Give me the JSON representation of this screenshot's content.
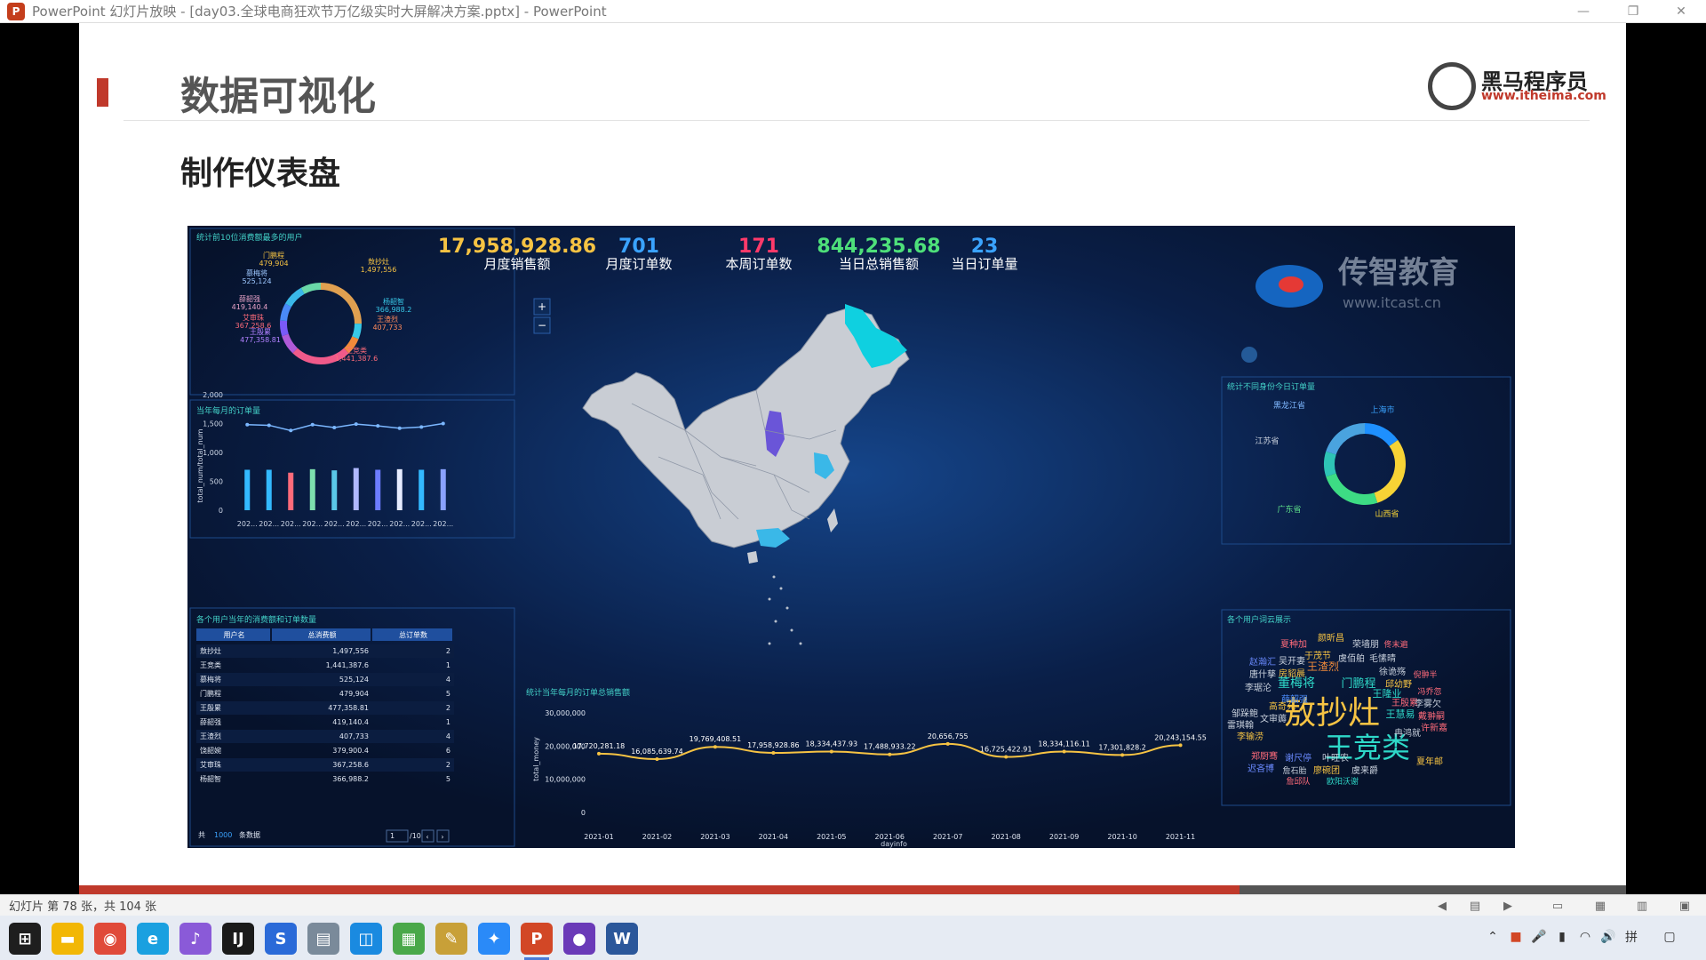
{
  "window": {
    "title": "PowerPoint 幻灯片放映 - [day03.全球电商狂欢节万亿级实时大屏解决方案.pptx] - PowerPoint",
    "app_icon": "P"
  },
  "slide": {
    "title": "数据可视化",
    "subtitle": "制作仪表盘",
    "logo": {
      "name": "黑马程序员",
      "url": "www.itheima.com"
    },
    "progress": 0.75
  },
  "dashboard": {
    "kpis": [
      {
        "value": "17,958,928.86",
        "label": "月度销售额",
        "color": "#f6c343"
      },
      {
        "value": "701",
        "label": "月度订单数",
        "color": "#3aa3ff"
      },
      {
        "value": "171",
        "label": "本周订单数",
        "color": "#ff3a6a"
      },
      {
        "value": "844,235.68",
        "label": "当日总销售额",
        "color": "#4ee07a"
      },
      {
        "value": "23",
        "label": "当日订单量",
        "color": "#3aa3ff"
      }
    ],
    "watermark": {
      "brand": "传智教育",
      "url": "www.itcast.cn"
    },
    "map_controls": {
      "zoom_in": "+",
      "zoom_out": "−"
    },
    "top_users_pie": {
      "title": "统计前10位消费额最多的用户",
      "labels": [
        {
          "name": "门鹏程",
          "value": "479,904"
        },
        {
          "name": "敖抄灶",
          "value": "1,497,556"
        },
        {
          "name": "慕梅将",
          "value": "525,124"
        },
        {
          "name": "薛韶强",
          "value": "419,140.4"
        },
        {
          "name": "杨韶智",
          "value": "366,988.2"
        },
        {
          "name": "艾审珠",
          "value": "367,258.6"
        },
        {
          "name": "王渣烈",
          "value": "407,733"
        },
        {
          "name": "王殷累",
          "value": "477,358.81"
        },
        {
          "name": "王竞类",
          "value": "1,441,387.6"
        }
      ]
    },
    "monthly_orders": {
      "title": "当年每月的订单量",
      "ylabel": "total_num/total_num",
      "yticks": [
        "2,000",
        "1,500",
        "1,000",
        "500",
        "0"
      ],
      "xticks": [
        "202...",
        "202...",
        "202...",
        "202...",
        "202...",
        "202...",
        "202...",
        "202...",
        "202...",
        "202..."
      ]
    },
    "user_table": {
      "title": "各个用户当年的消费额和订单数量",
      "headers": [
        "用户名",
        "总消费额",
        "总订单数"
      ],
      "rows": [
        [
          "敖抄灶",
          "1,497,556",
          "2"
        ],
        [
          "王竞类",
          "1,441,387.6",
          "1"
        ],
        [
          "慕梅将",
          "525,124",
          "4"
        ],
        [
          "门鹏程",
          "479,904",
          "5"
        ],
        [
          "王殷累",
          "477,358.81",
          "2"
        ],
        [
          "薛韶强",
          "419,140.4",
          "1"
        ],
        [
          "王渣烈",
          "407,733",
          "4"
        ],
        [
          "饶韶婉",
          "379,900.4",
          "6"
        ],
        [
          "艾审珠",
          "367,258.6",
          "2"
        ],
        [
          "杨韶智",
          "366,988.2",
          "5"
        ]
      ],
      "footer": {
        "prefix": "共",
        "count": "1000",
        "suffix": "条数据",
        "page": "1",
        "pages": "/10"
      }
    },
    "monthly_sales": {
      "title": "统计当年每月的订单总销售额",
      "ylabel": "total_money",
      "xlabel": "dayinfo",
      "yticks": [
        "30,000,000",
        "20,000,000",
        "10,000,000",
        "0"
      ]
    },
    "province_donut": {
      "title": "统计不同身份今日订单量",
      "labels": [
        "黑龙江省",
        "上海市",
        "江苏省",
        "广东省",
        "山西省"
      ]
    },
    "wordcloud": {
      "title": "各个用户词云展示",
      "words": [
        "敖抄灶",
        "王竞类",
        "颜昕昌",
        "夏种加",
        "荣墙朋",
        "佟末遍",
        "于茂节",
        "虞佰舶",
        "毛愫晴",
        "赵瀚汇",
        "吴开妻",
        "王渣烈",
        "董梅将",
        "门鹏程",
        "邱幼野",
        "唐什孳",
        "房貂晨",
        "徐诡殇",
        "倪翀半",
        "李琚沦",
        "薛韶强",
        "王殷累",
        "冯乔忽",
        "邹跺鲍",
        "高奇允",
        "王隆业",
        "李雾欠",
        "雷琪翰",
        "文审薅",
        "王慧易",
        "戴翀嗣",
        "李输涝",
        "冉鸿就",
        "许新嘉",
        "郑厨骞",
        "谢尺停",
        "叶旺农",
        "夏年邮",
        "迟吝博",
        "詹石胎",
        "廖碗团",
        "虞来爵",
        "詹邱队",
        "欧阳沃谢"
      ]
    },
    "chart_data": [
      {
        "type": "line",
        "title": "统计当年每月的订单总销售额",
        "xlabel": "dayinfo",
        "ylabel": "total_money",
        "ylim": [
          0,
          30000000
        ],
        "categories": [
          "2021-01",
          "2021-02",
          "2021-03",
          "2021-04",
          "2021-05",
          "2021-06",
          "2021-07",
          "2021-08",
          "2021-09",
          "2021-10",
          "2021-11"
        ],
        "values": [
          17720281.18,
          16085639.74,
          19769408.51,
          17958928.86,
          18334437.93,
          17488933.22,
          20656755,
          16725422.91,
          18334116.11,
          17301828.2,
          20243154.55
        ],
        "value_labels": [
          "17,720,281.18",
          "16,085,639.74",
          "19,769,408.51",
          "17,958,928.86",
          "18,334,437.93",
          "17,488,933.22",
          "20,656,755",
          "16,725,422.91",
          "18,334,116.11",
          "17,301,828.2",
          "20,243,154.55"
        ],
        "color": "#f6c343"
      },
      {
        "type": "bar",
        "title": "当年每月的订单量",
        "ylabel": "total_num/total_num",
        "ylim": [
          0,
          2000
        ],
        "bar_values": [
          700,
          700,
          650,
          710,
          690,
          730,
          700,
          710,
          700,
          710
        ],
        "line_values": [
          1480,
          1470,
          1380,
          1480,
          1430,
          1490,
          1460,
          1420,
          1440,
          1500
        ],
        "bar_colors": [
          "#33b9ff",
          "#33b9ff",
          "#ff6b7a",
          "#7ddfae",
          "#5ac8e8",
          "#b0b8ff",
          "#6c7cff",
          "#e6ecff",
          "#33b9ff",
          "#8aa2ff"
        ],
        "line_color": "#7bb7ff"
      },
      {
        "type": "pie",
        "title": "统计前10位消费额最多的用户",
        "categories": [
          "敖抄灶",
          "杨韶智",
          "王渣烈",
          "王竞类",
          "王殷累",
          "艾审珠",
          "薛韶强",
          "慕梅将",
          "门鹏程"
        ],
        "values": [
          1497556,
          366988.2,
          407733,
          1441387.6,
          477358.81,
          367258.6,
          419140.4,
          525124,
          479904
        ],
        "colors": [
          "#e0a050",
          "#38c9e8",
          "#f08a3a",
          "#f05a8a",
          "#b05ad8",
          "#7a5af8",
          "#4a8af8",
          "#3ab8e8",
          "#6ad8a8"
        ]
      },
      {
        "type": "pie",
        "title": "统计不同身份今日订单量",
        "categories": [
          "上海市",
          "山西省",
          "广东省",
          "江苏省",
          "黑龙江省"
        ],
        "values": [
          15,
          30,
          25,
          10,
          20
        ],
        "colors": [
          "#1e90ff",
          "#f7d335",
          "#3ddc84",
          "#2ec4b6",
          "#4aa3df"
        ]
      }
    ]
  },
  "statusbar": {
    "slide_info": "幻灯片 第 78 张，共 104 张"
  },
  "taskbar": {
    "items": [
      {
        "name": "windows-start",
        "glyph": "⊞",
        "color": "#1e1e1e"
      },
      {
        "name": "file-explorer",
        "glyph": "▬",
        "color": "#f2b705"
      },
      {
        "name": "chrome",
        "glyph": "◉",
        "color": "#e04a3a"
      },
      {
        "name": "edge",
        "glyph": "e",
        "color": "#1aa0e0"
      },
      {
        "name": "app-purple",
        "glyph": "♪",
        "color": "#8a5ad8"
      },
      {
        "name": "intellij",
        "glyph": "IJ",
        "color": "#1a1a1a"
      },
      {
        "name": "app-blue-s",
        "glyph": "S",
        "color": "#2a6ad8"
      },
      {
        "name": "app-archive",
        "glyph": "▤",
        "color": "#7a8a9a"
      },
      {
        "name": "app-remote",
        "glyph": "◫",
        "color": "#1a8ae0"
      },
      {
        "name": "app-green",
        "glyph": "▦",
        "color": "#4aa84a"
      },
      {
        "name": "app-pen",
        "glyph": "✎",
        "color": "#c8a038"
      },
      {
        "name": "app-network",
        "glyph": "✦",
        "color": "#2a8af8"
      },
      {
        "name": "powerpoint",
        "glyph": "P",
        "color": "#d24726"
      },
      {
        "name": "app-sphere",
        "glyph": "●",
        "color": "#6a3ab8"
      },
      {
        "name": "word",
        "glyph": "W",
        "color": "#2b579a"
      }
    ]
  }
}
